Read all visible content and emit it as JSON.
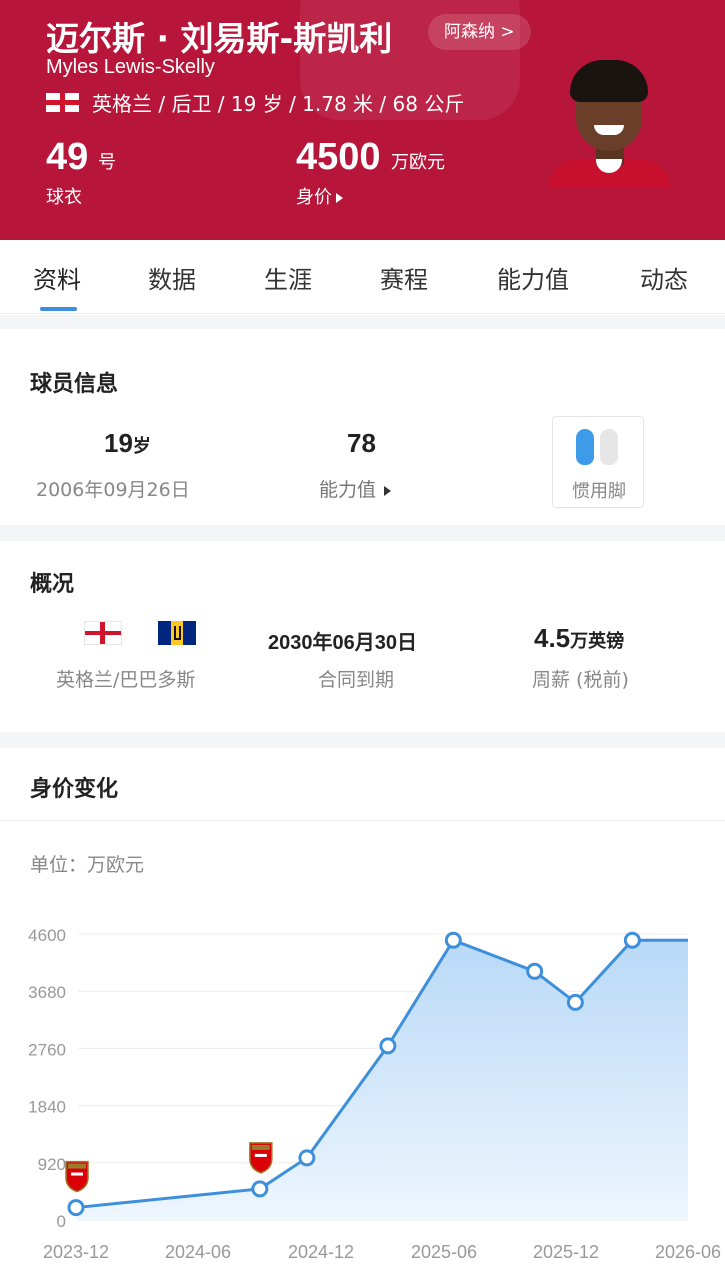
{
  "header": {
    "name_cn": "迈尔斯 · 刘易斯-斯凯利",
    "club": "阿森纳 >",
    "name_en": "Myles Lewis-Skelly",
    "meta": "英格兰 / 后卫 / 19 岁 / 1.78 米 / 68 公斤",
    "shirt_number": "49",
    "shirt_unit": "号",
    "shirt_label": "球衣",
    "value_number": "4500",
    "value_unit": "万欧元",
    "value_label": "身价",
    "colors": {
      "brand": "#b7153a",
      "accent": "#3d8fdc"
    }
  },
  "tabs": [
    "资料",
    "数据",
    "生涯",
    "赛程",
    "能力值",
    "动态"
  ],
  "player_info": {
    "title": "球员信息",
    "age_value": "19",
    "age_unit": "岁",
    "birthdate": "2006年09月26日",
    "ability_value": "78",
    "ability_label": "能力值",
    "foot_label": "惯用脚"
  },
  "overview": {
    "title": "概况",
    "nationality": "英格兰/巴巴多斯",
    "contract_date": "2030年06月30日",
    "contract_label": "合同到期",
    "wage_value": "4.5",
    "wage_unit": "万英镑",
    "wage_label": "周薪 (税前)"
  },
  "value_change": {
    "title": "身价变化",
    "unit_label": "单位：万欧元"
  },
  "chart_data": {
    "type": "area",
    "ylabel": "单位：万欧元",
    "ylim": [
      0,
      4600
    ],
    "yticks": [
      "4600",
      "3680",
      "2760",
      "1840",
      "920",
      "0"
    ],
    "xticks": [
      "2023-12",
      "2024-06",
      "2024-12",
      "2025-06",
      "2025-12",
      "2026-06"
    ],
    "x_range": [
      "2023-12-01",
      "2026-06-01"
    ],
    "points": [
      {
        "x": "2023-12-01",
        "y": 200,
        "club_badge": true
      },
      {
        "x": "2024-09-01",
        "y": 500,
        "club_badge": true
      },
      {
        "x": "2024-11-10",
        "y": 1000
      },
      {
        "x": "2025-03-10",
        "y": 2800
      },
      {
        "x": "2025-06-15",
        "y": 4500
      },
      {
        "x": "2025-10-15",
        "y": 4000
      },
      {
        "x": "2025-12-15",
        "y": 3500
      },
      {
        "x": "2026-03-10",
        "y": 4500
      }
    ],
    "grid": true,
    "line_color": "#3d8fdc",
    "fill_color": "#d6e9fb",
    "badge_label": "Arsenal"
  }
}
